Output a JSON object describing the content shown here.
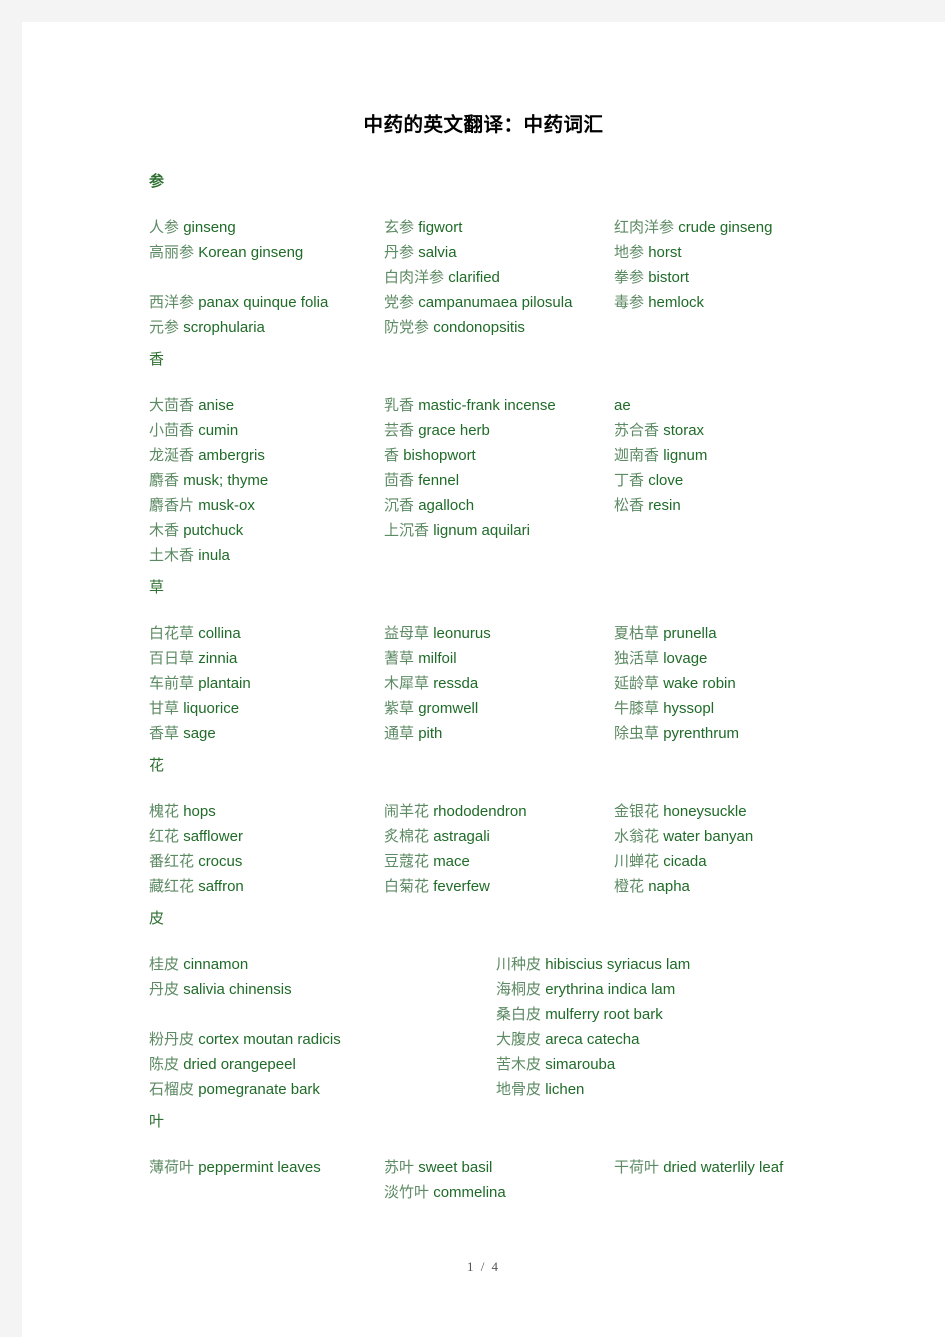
{
  "document": {
    "title": "中药的英文翻译：中药词汇",
    "footer": "1 / 4",
    "accent_color": "#2e7031",
    "cn_color": "#5c8a63",
    "en_color": "#1f6b28"
  },
  "sections": [
    {
      "header": "参",
      "header_bold": true,
      "layout": "three-column",
      "columns": [
        [
          {
            "cn": "人参",
            "en": "ginseng"
          },
          {
            "cn": "高丽参",
            "en": "Korean ginseng"
          },
          {
            "blank": true
          },
          {
            "cn": "西洋参",
            "en": "panax quinque folia"
          },
          {
            "cn": "元参",
            "en": "scrophularia"
          }
        ],
        [
          {
            "cn": "玄参",
            "en": "figwort"
          },
          {
            "cn": "丹参",
            "en": "salvia"
          },
          {
            "cn": "白肉洋参",
            "en": "clarified"
          },
          {
            "cn": "党参",
            "en": "campanumaea pilosula"
          },
          {
            "cn": "防党参",
            "en": "condonopsitis"
          }
        ],
        [
          {
            "cn": "红肉洋参",
            "en": "crude ginseng"
          },
          {
            "cn": "地参",
            "en": "horst"
          },
          {
            "cn": "拳参",
            "en": "bistort"
          },
          {
            "cn": "毒参",
            "en": "hemlock"
          }
        ]
      ]
    },
    {
      "header": "香",
      "header_bold": false,
      "layout": "three-column",
      "columns": [
        [
          {
            "cn": "大茴香",
            "en": "anise"
          },
          {
            "cn": "小茴香",
            "en": "cumin"
          },
          {
            "cn": "龙涎香",
            "en": "ambergris"
          },
          {
            "cn": "麝香",
            "en": "musk; thyme"
          },
          {
            "cn": "麝香片",
            "en": "musk-ox"
          },
          {
            "cn": "木香",
            "en": "putchuck"
          },
          {
            "cn": "土木香",
            "en": "inula"
          }
        ],
        [
          {
            "cn": "乳香",
            "en": "mastic-frank incense"
          },
          {
            "cn": "芸香",
            "en": "grace herb"
          },
          {
            "cn": "香",
            "en": "bishopwort"
          },
          {
            "cn": "茴香",
            "en": "fennel"
          },
          {
            "cn": "沉香",
            "en": "agalloch"
          },
          {
            "cn": "上沉香",
            "en": "lignum aquilari"
          }
        ],
        [
          {
            "cn": "",
            "en": "ae"
          },
          {
            "cn": "苏合香",
            "en": "storax"
          },
          {
            "cn": "迦南香",
            "en": "lignum"
          },
          {
            "cn": "丁香",
            "en": "clove"
          },
          {
            "cn": "松香",
            "en": "resin"
          }
        ]
      ]
    },
    {
      "header": "草",
      "header_bold": false,
      "layout": "three-column",
      "columns": [
        [
          {
            "cn": "白花草",
            "en": "collina"
          },
          {
            "cn": "百日草",
            "en": "zinnia"
          },
          {
            "cn": "车前草",
            "en": "plantain"
          },
          {
            "cn": "甘草",
            "en": "liquorice"
          },
          {
            "cn": "香草",
            "en": "sage"
          }
        ],
        [
          {
            "cn": "益母草",
            "en": "leonurus"
          },
          {
            "cn": "蓍草",
            "en": "milfoil"
          },
          {
            "cn": "木犀草",
            "en": "ressda"
          },
          {
            "cn": "紫草",
            "en": "gromwell"
          },
          {
            "cn": "通草",
            "en": "pith"
          }
        ],
        [
          {
            "cn": "夏枯草",
            "en": "prunella"
          },
          {
            "cn": "独活草",
            "en": "lovage"
          },
          {
            "cn": "延龄草",
            "en": "wake robin"
          },
          {
            "cn": "牛膝草",
            "en": "hyssopl"
          },
          {
            "cn": "除虫草",
            "en": "pyrenthrum"
          }
        ]
      ]
    },
    {
      "header": "花",
      "header_bold": false,
      "layout": "three-column",
      "columns": [
        [
          {
            "cn": "槐花",
            "en": "hops"
          },
          {
            "cn": "红花",
            "en": "safflower"
          },
          {
            "cn": "番红花",
            "en": "crocus"
          },
          {
            "cn": "藏红花",
            "en": "saffron"
          }
        ],
        [
          {
            "cn": "闹羊花",
            "en": "rhododendron"
          },
          {
            "cn": "炙棉花",
            "en": "astragali"
          },
          {
            "cn": "豆蔻花",
            "en": "mace"
          },
          {
            "cn": "白菊花",
            "en": "feverfew"
          }
        ],
        [
          {
            "cn": "金银花",
            "en": "honeysuckle"
          },
          {
            "cn": "水翁花",
            "en": "water banyan"
          },
          {
            "cn": "川蝉花",
            "en": "cicada"
          },
          {
            "cn": "橙花",
            "en": "napha"
          }
        ]
      ]
    },
    {
      "header": "皮",
      "header_bold": false,
      "layout": "two-column",
      "columns": [
        [
          {
            "cn": "桂皮",
            "en": "cinnamon"
          },
          {
            "cn": "丹皮",
            "en": "salivia chinensis"
          },
          {
            "blank": true
          },
          {
            "cn": "粉丹皮",
            "en": "cortex moutan radicis"
          },
          {
            "cn": "陈皮",
            "en": "dried orangepeel"
          },
          {
            "cn": "石榴皮",
            "en": "pomegranate bark"
          }
        ],
        [
          {
            "cn": "川种皮",
            "en": "hibiscius syriacus lam"
          },
          {
            "cn": "海桐皮",
            "en": "erythrina indica lam"
          },
          {
            "cn": "桑白皮",
            "en": "mulferry root bark"
          },
          {
            "cn": "大腹皮",
            "en": "areca catecha"
          },
          {
            "cn": "苦木皮",
            "en": "simarouba"
          },
          {
            "cn": "地骨皮",
            "en": "lichen"
          }
        ]
      ]
    },
    {
      "header": "叶",
      "header_bold": false,
      "layout": "three-column",
      "columns": [
        [
          {
            "cn": "薄荷叶",
            "en": "peppermint leaves"
          }
        ],
        [
          {
            "cn": "苏叶",
            "en": "sweet basil"
          },
          {
            "cn": "淡竹叶",
            "en": "commelina"
          }
        ],
        [
          {
            "cn": "干荷叶",
            "en": "dried waterlily leaf"
          }
        ]
      ]
    }
  ]
}
